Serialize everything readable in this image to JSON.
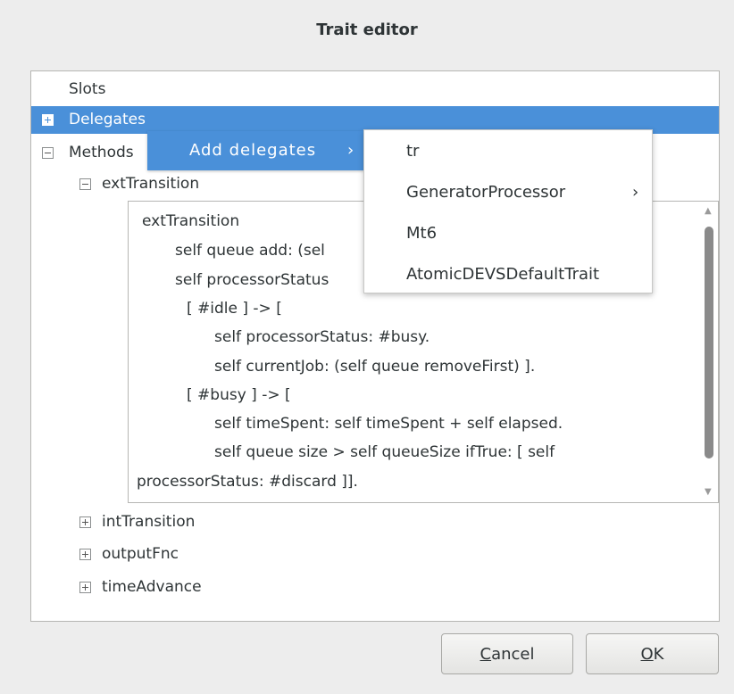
{
  "dialog": {
    "title": "Trait editor"
  },
  "tree": {
    "slots": "Slots",
    "delegates": "Delegates",
    "methods": "Methods",
    "ext_transition": "extTransition",
    "int_transition": "intTransition",
    "output_fnc": "outputFnc",
    "time_advance": "timeAdvance"
  },
  "code": {
    "lines": [
      "extTransition",
      "self queue add: (sel",
      "self processorStatus",
      "[ #idle ] -> [",
      "self processorStatus: #busy.",
      "self currentJob: (self queue removeFirst) ].",
      "[ #busy ] -> [",
      "self timeSpent: self timeSpent + self elapsed.",
      "self queue size > self queueSize ifTrue: [ self",
      "processorStatus: #discard ]]."
    ]
  },
  "context_menu": {
    "add_delegates": "Add delegates",
    "submenu_arrow": "›",
    "items": [
      {
        "label": "tr",
        "has_submenu": false
      },
      {
        "label": "GeneratorProcessor",
        "has_submenu": true
      },
      {
        "label": "Mt6",
        "has_submenu": false
      },
      {
        "label": "AtomicDEVSDefaultTrait",
        "has_submenu": false
      }
    ]
  },
  "buttons": {
    "cancel_mnemonic": "C",
    "cancel_rest": "ancel",
    "ok_mnemonic": "O",
    "ok_rest": "K"
  },
  "colors": {
    "accent": "#4a90d9",
    "background": "#ededed"
  }
}
